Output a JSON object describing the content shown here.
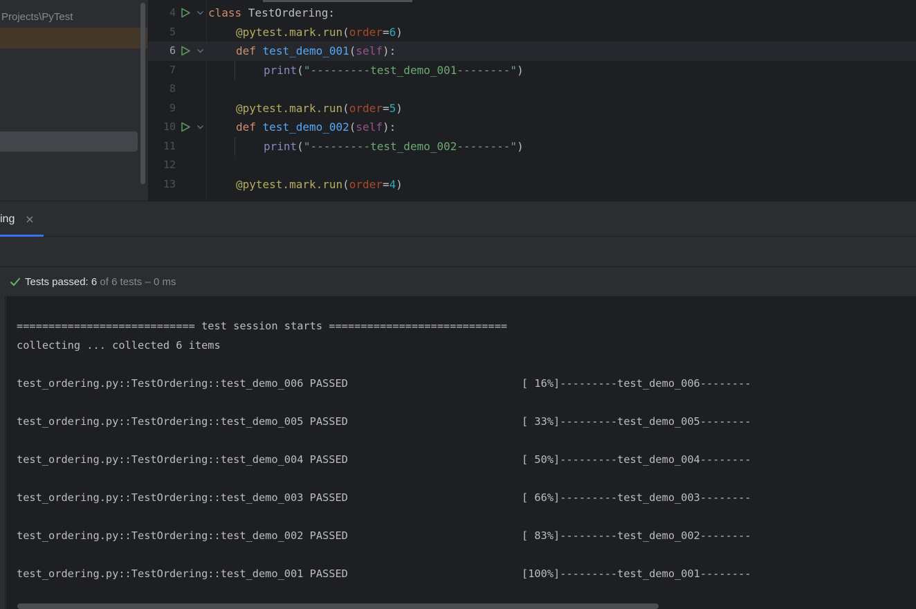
{
  "project": {
    "path_text": "Projects\\PyTest"
  },
  "editor": {
    "lines": [
      {
        "num": "4"
      },
      {
        "num": "5"
      },
      {
        "num": "6"
      },
      {
        "num": "7"
      },
      {
        "num": "8"
      },
      {
        "num": "9"
      },
      {
        "num": "10"
      },
      {
        "num": "11"
      },
      {
        "num": "12"
      },
      {
        "num": "13"
      }
    ],
    "tokens": {
      "kw_class": "class",
      "class_name": " TestOrdering:",
      "decorator": "@pytest.mark.run",
      "paren_open": "(",
      "paren_close": ")",
      "param_order": "order",
      "eq": "=",
      "order_6": "6",
      "order_5": "5",
      "order_4": "4",
      "kw_def": "def",
      "fn_001": "test_demo_001",
      "fn_002": "test_demo_002",
      "self": "self",
      "sig_end": "):",
      "print": "print",
      "str_001": "\"---------test_demo_001--------\"",
      "str_002": "\"---------test_demo_002--------\""
    }
  },
  "run": {
    "tab_label": "ing",
    "status_prefix": "Tests passed: 6",
    "status_detail": " of 6 tests – 0 ms",
    "console": {
      "session_line": "============================ test session starts ============================",
      "collecting_line": "collecting ... collected 6 items",
      "results": [
        {
          "test": "test_ordering.py::TestOrdering::test_demo_006 PASSED",
          "progress": "[ 16%]---------test_demo_006--------"
        },
        {
          "test": "test_ordering.py::TestOrdering::test_demo_005 PASSED",
          "progress": "[ 33%]---------test_demo_005--------"
        },
        {
          "test": "test_ordering.py::TestOrdering::test_demo_004 PASSED",
          "progress": "[ 50%]---------test_demo_004--------"
        },
        {
          "test": "test_ordering.py::TestOrdering::test_demo_003 PASSED",
          "progress": "[ 66%]---------test_demo_003--------"
        },
        {
          "test": "test_ordering.py::TestOrdering::test_demo_002 PASSED",
          "progress": "[ 83%]---------test_demo_002--------"
        },
        {
          "test": "test_ordering.py::TestOrdering::test_demo_001 PASSED",
          "progress": "[100%]---------test_demo_001--------"
        }
      ]
    }
  },
  "colors": {
    "accent": "#3574f0",
    "pass_green": "#5fb865",
    "run_green": "#57965c"
  },
  "icons": {
    "run_gutter": "run-gutter-icon",
    "fold": "fold-chevron-icon",
    "close": "close-icon",
    "check": "check-icon"
  }
}
